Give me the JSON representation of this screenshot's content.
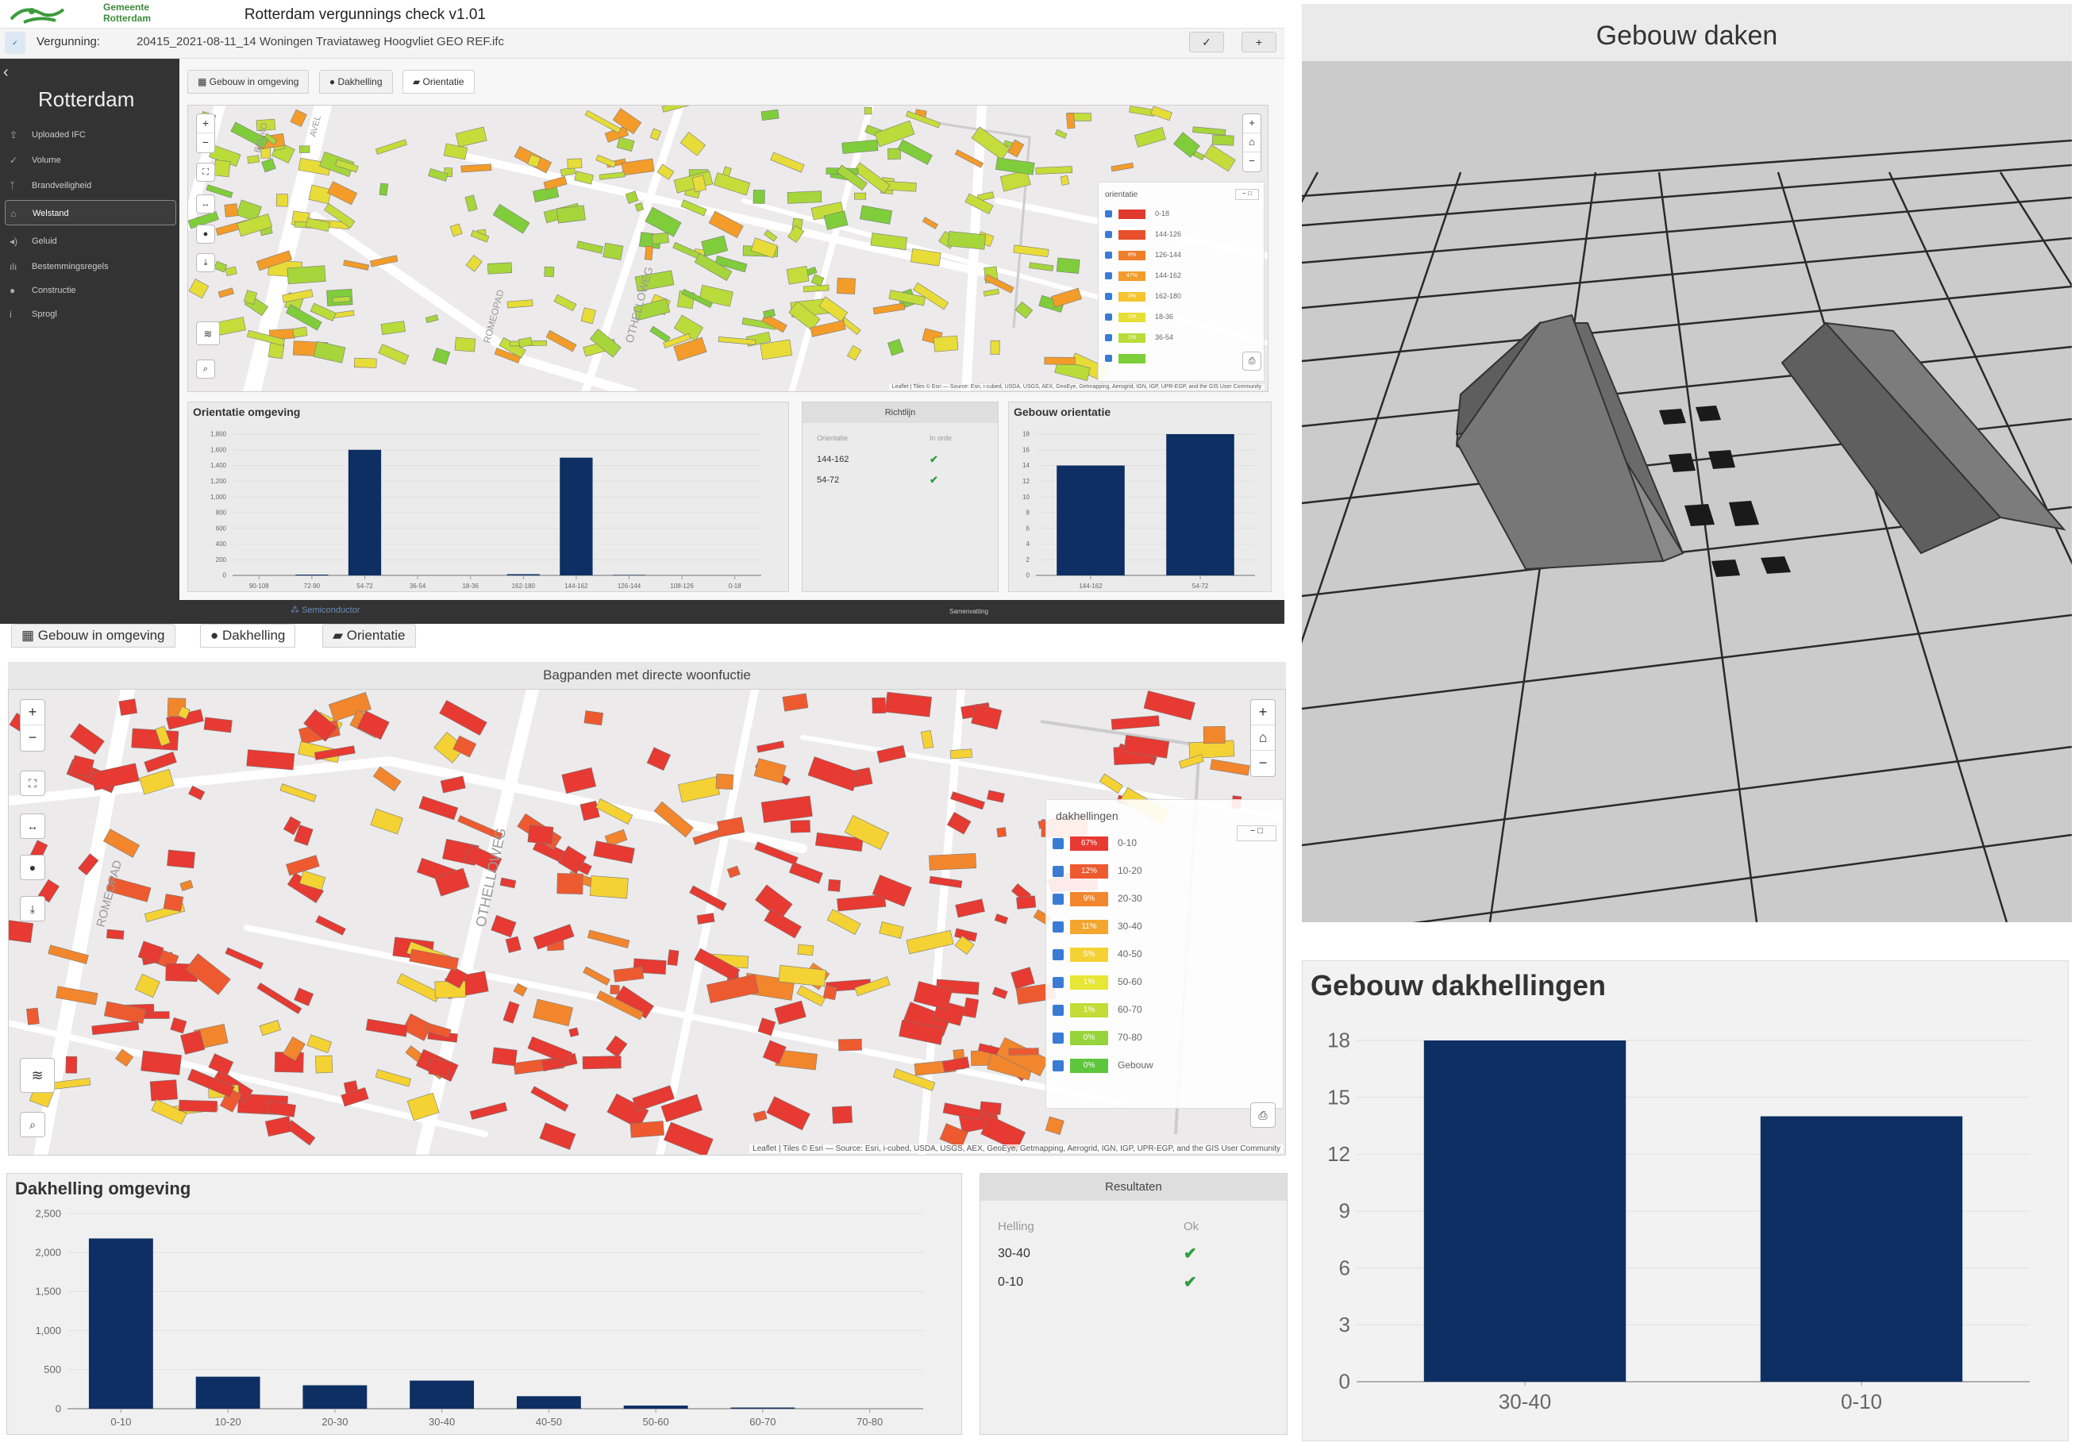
{
  "header": {
    "logo_line1": "Gemeente",
    "logo_line2": "Rotterdam",
    "app_title": "Rotterdam vergunnings check v1.01",
    "vergunning_label": "Vergunning:",
    "vergunning_value": "20415_2021-08-11_14 Woningen Traviataweg Hoogvliet GEO REF.ifc",
    "btn_check": "✓",
    "btn_add": "+"
  },
  "sidebar": {
    "title": "Rotterdam",
    "items": [
      {
        "label": "Uploaded IFC",
        "icon": "upload-icon"
      },
      {
        "label": "Volume",
        "icon": "check-icon"
      },
      {
        "label": "Brandveiligheid",
        "icon": "fire-icon"
      },
      {
        "label": "Welstand",
        "icon": "building-icon"
      },
      {
        "label": "Geluid",
        "icon": "sound-icon"
      },
      {
        "label": "Bestemmingsregels",
        "icon": "rules-icon"
      },
      {
        "label": "Constructie",
        "icon": "construction-icon"
      },
      {
        "label": "Sprogl",
        "icon": "info-icon"
      }
    ]
  },
  "tabs_top": [
    "Gebouw in omgeving",
    "Dakhelling",
    "Orientatie"
  ],
  "map_top": {
    "legend_title": "orientatie",
    "legend": [
      {
        "pct": "",
        "label": "0-18",
        "color": "#e03a2f"
      },
      {
        "pct": "",
        "label": "144-126",
        "color": "#e8502b"
      },
      {
        "pct": "8%",
        "label": "126-144",
        "color": "#f07d27"
      },
      {
        "pct": "47%",
        "label": "144-162",
        "color": "#f39c2a"
      },
      {
        "pct": "3%",
        "label": "162-180",
        "color": "#f6c42f"
      },
      {
        "pct": "1%",
        "label": "18-36",
        "color": "#e6dd35"
      },
      {
        "pct": "1%",
        "label": "36-54",
        "color": "#b9dc3a"
      },
      {
        "pct": "",
        "label": "",
        "color": "#7ccf3a"
      }
    ],
    "street1": "OTHELLOWEG",
    "street2": "ROMEOPAD",
    "street3": "BELMO",
    "street4": "AVEL",
    "attribution": "Leaflet | Tiles © Esri — Source: Esri, i-cubed, USDA, USGS, AEX, GeoEye, Getmapping, Aerogrid, IGN, IGP, UPR-EGP, and the GIS User Community"
  },
  "orientatie_omgeving": {
    "title": "Orientatie omgeving",
    "chart_data": {
      "type": "bar",
      "categories": [
        "90-108",
        "72-90",
        "54-72",
        "36-54",
        "18-36",
        "162-180",
        "144-162",
        "126-144",
        "108-126",
        "0-18"
      ],
      "values": [
        0,
        10,
        1600,
        0,
        0,
        15,
        1500,
        5,
        0,
        0
      ],
      "ylim": [
        0,
        1800
      ],
      "yticks": [
        "0",
        "200",
        "400",
        "600",
        "800",
        "1,000",
        "1,200",
        "1,400",
        "1,600",
        "1,800"
      ]
    }
  },
  "richtlijn": {
    "title": "Richtlijn",
    "col1": "Orientatie",
    "col2": "In orde",
    "rows": [
      {
        "value": "144-162",
        "ok": "✔"
      },
      {
        "value": "54-72",
        "ok": "✔"
      }
    ]
  },
  "gebouw_orientatie": {
    "title": "Gebouw orientatie",
    "chart_data": {
      "type": "bar",
      "categories": [
        "144-162",
        "54-72"
      ],
      "values": [
        14,
        18
      ],
      "ylim": [
        0,
        18
      ],
      "yticks": [
        "0",
        "2",
        "4",
        "6",
        "8",
        "10",
        "12",
        "14",
        "16",
        "18"
      ]
    }
  },
  "footer_link": "Samenvatting",
  "footer_brand": "Semiconductor",
  "tabs_bottom": [
    "Gebouw in omgeving",
    "Dakhelling",
    "Orientatie"
  ],
  "map_bottom": {
    "title": "Bagpanden met directe woonfuctie",
    "legend_title": "dakhellingen",
    "legend": [
      {
        "pct": "67%",
        "label": "0-10",
        "color": "#e63a32"
      },
      {
        "pct": "12%",
        "label": "10-20",
        "color": "#ee5a30"
      },
      {
        "pct": "9%",
        "label": "20-30",
        "color": "#f2862d"
      },
      {
        "pct": "11%",
        "label": "30-40",
        "color": "#f3a52e"
      },
      {
        "pct": "5%",
        "label": "40-50",
        "color": "#f4d233"
      },
      {
        "pct": "1%",
        "label": "50-60",
        "color": "#e7e536"
      },
      {
        "pct": "1%",
        "label": "60-70",
        "color": "#c3dc37"
      },
      {
        "pct": "0%",
        "label": "70-80",
        "color": "#97d33a"
      },
      {
        "pct": "0%",
        "label": "Gebouw",
        "color": "#5ec63c"
      }
    ],
    "street1": "OTHELLOWEG",
    "street2": "ROMEOPAD",
    "attribution": "Leaflet | Tiles © Esri — Source: Esri, i-cubed, USDA, USGS, AEX, GeoEye, Getmapping, Aerogrid, IGN, IGP, UPR-EGP, and the GIS User Community"
  },
  "dakhelling_omgeving": {
    "title": "Dakhelling omgeving",
    "chart_data": {
      "type": "bar",
      "categories": [
        "0-10",
        "10-20",
        "20-30",
        "30-40",
        "40-50",
        "50-60",
        "60-70",
        "70-80"
      ],
      "values": [
        2180,
        410,
        300,
        360,
        160,
        40,
        15,
        0
      ],
      "ylim": [
        0,
        2500
      ],
      "yticks": [
        "0",
        "500",
        "1,000",
        "1,500",
        "2,000",
        "2,500"
      ]
    }
  },
  "resultaten": {
    "title": "Resultaten",
    "col1": "Helling",
    "col2": "Ok",
    "rows": [
      {
        "value": "30-40",
        "ok": "✔"
      },
      {
        "value": "0-10",
        "ok": "✔"
      }
    ]
  },
  "gebouw_daken": {
    "title": "Gebouw daken"
  },
  "gebouw_dakhellingen": {
    "title": "Gebouw dakhellingen",
    "chart_data": {
      "type": "bar",
      "categories": [
        "30-40",
        "0-10"
      ],
      "values": [
        18,
        14
      ],
      "ylim": [
        0,
        18
      ],
      "yticks": [
        "0",
        "3",
        "6",
        "9",
        "12",
        "15",
        "18"
      ]
    }
  },
  "colors": {
    "bar": "#0d2f63",
    "sidebar": "#333333",
    "accent_check": "#2e9e3e"
  }
}
